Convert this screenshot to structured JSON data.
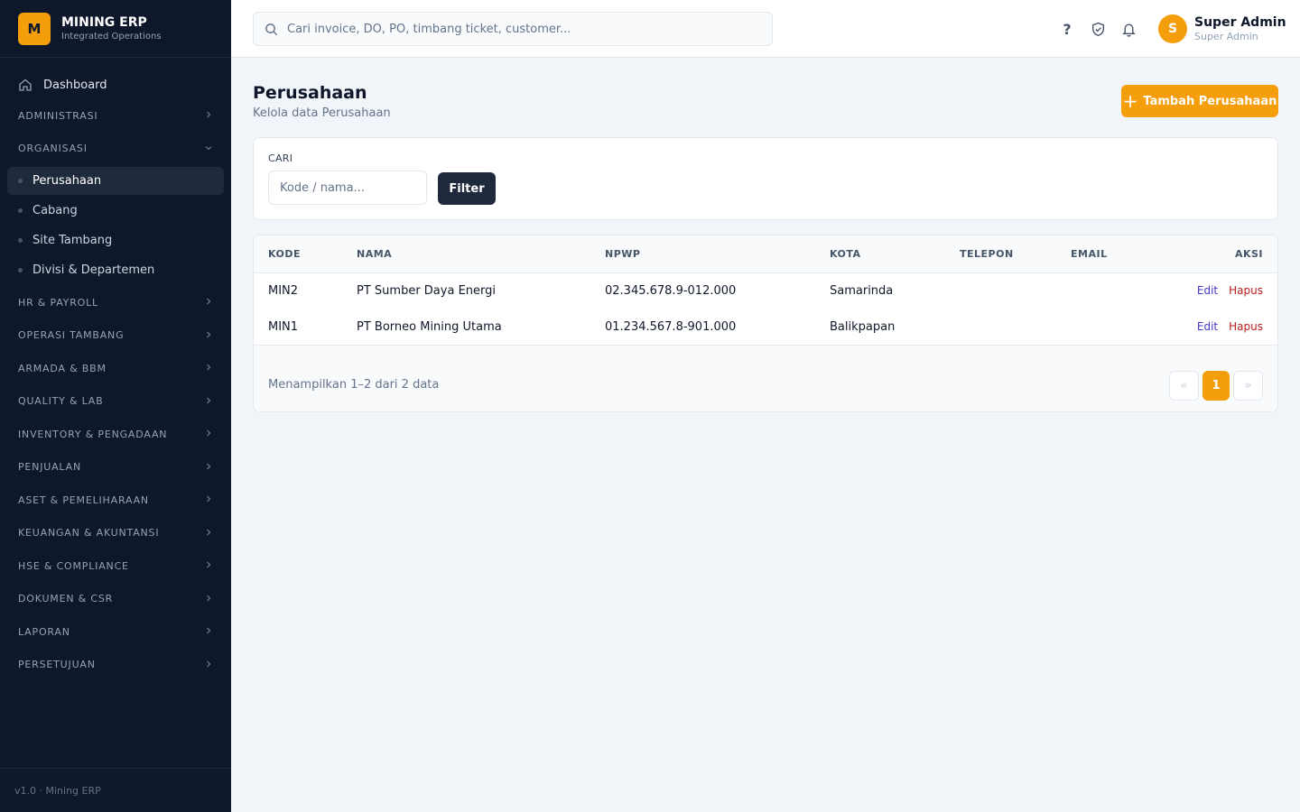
{
  "brand": {
    "logo_letter": "M",
    "name": "MINING ERP",
    "tagline": "Integrated Operations"
  },
  "sidebar": {
    "dashboard": "Dashboard",
    "sections": [
      {
        "label": "ADMINISTRASI",
        "expanded": false
      },
      {
        "label": "ORGANISASI",
        "expanded": true,
        "items": [
          "Perusahaan",
          "Cabang",
          "Site Tambang",
          "Divisi & Departemen"
        ],
        "active": "Perusahaan"
      },
      {
        "label": "HR & PAYROLL",
        "expanded": false
      },
      {
        "label": "OPERASI TAMBANG",
        "expanded": false
      },
      {
        "label": "ARMADA & BBM",
        "expanded": false
      },
      {
        "label": "QUALITY & LAB",
        "expanded": false
      },
      {
        "label": "INVENTORY & PENGADAAN",
        "expanded": false
      },
      {
        "label": "PENJUALAN",
        "expanded": false
      },
      {
        "label": "ASET & PEMELIHARAAN",
        "expanded": false
      },
      {
        "label": "KEUANGAN & AKUNTANSI",
        "expanded": false
      },
      {
        "label": "HSE & COMPLIANCE",
        "expanded": false
      },
      {
        "label": "DOKUMEN & CSR",
        "expanded": false
      },
      {
        "label": "LAPORAN",
        "expanded": false
      },
      {
        "label": "PERSETUJUAN",
        "expanded": false
      }
    ],
    "footer": "v1.0 · Mining ERP"
  },
  "topbar": {
    "search_placeholder": "Cari invoice, DO, PO, timbang ticket, customer...",
    "help_label": "?",
    "user": {
      "initial": "S",
      "name": "Super Admin",
      "role": "Super Admin"
    }
  },
  "page": {
    "title": "Perusahaan",
    "subtitle": "Kelola data Perusahaan",
    "add_button": "Tambah Perusahaan"
  },
  "filter": {
    "label": "CARI",
    "placeholder": "Kode / nama...",
    "button": "Filter"
  },
  "table": {
    "columns": [
      "KODE",
      "NAMA",
      "NPWP",
      "KOTA",
      "TELEPON",
      "EMAIL",
      "AKSI"
    ],
    "rows": [
      {
        "kode": "MIN2",
        "nama": "PT Sumber Daya Energi",
        "npwp": "02.345.678.9-012.000",
        "kota": "Samarinda",
        "telepon": "",
        "email": ""
      },
      {
        "kode": "MIN1",
        "nama": "PT Borneo Mining Utama",
        "npwp": "01.234.567.8-901.000",
        "kota": "Balikpapan",
        "telepon": "",
        "email": ""
      }
    ],
    "edit_label": "Edit",
    "delete_label": "Hapus",
    "footer_info": "Menampilkan 1–2 dari 2 data",
    "pager": {
      "prev": "«",
      "current": "1",
      "next": "»"
    }
  }
}
